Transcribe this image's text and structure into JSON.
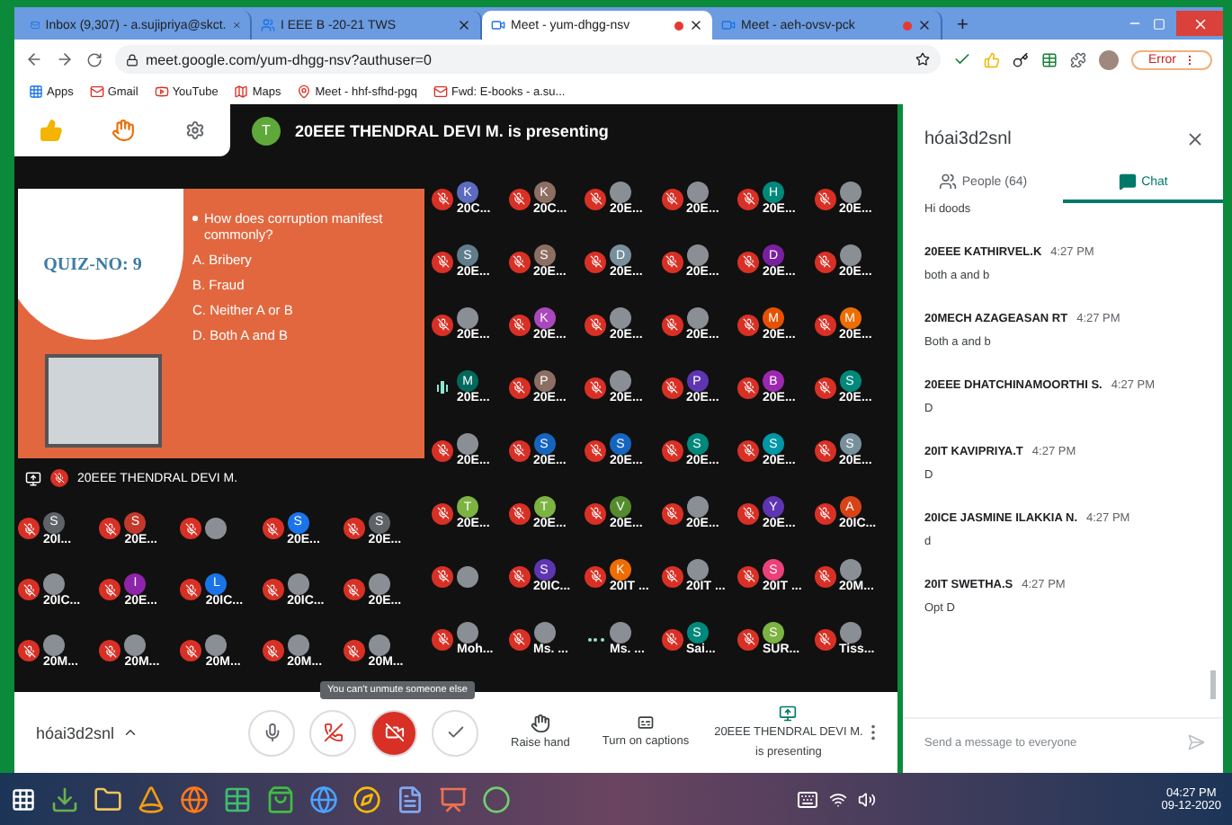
{
  "browser": {
    "tabs": [
      {
        "title": "Inbox (9,307) - a.sujipriya@skct.",
        "kind": "mail",
        "selected": false,
        "recording": false
      },
      {
        "title": "I EEE B -20-21 TWS",
        "kind": "people",
        "selected": false,
        "recording": false
      },
      {
        "title": "Meet - yum-dhgg-nsv",
        "kind": "meet",
        "selected": true,
        "recording": true
      },
      {
        "title": "Meet - aeh-ovsv-pck",
        "kind": "meet",
        "selected": false,
        "recording": true
      }
    ],
    "new_tab": "+",
    "address": "meet.google.com/yum-dhgg-nsv?authuser=0",
    "profile_button": "Error",
    "bookmarks": [
      {
        "label": "Apps",
        "kind": "apps"
      },
      {
        "label": "Gmail",
        "kind": "mail"
      },
      {
        "label": "YouTube",
        "kind": "video"
      },
      {
        "label": "Maps",
        "kind": "map"
      },
      {
        "label": "Meet - hhf-sfhd-pgq",
        "kind": "pin"
      },
      {
        "label": "Fwd: E-books - a.su...",
        "kind": "mail"
      }
    ]
  },
  "meet": {
    "banner": {
      "initial": "T",
      "text": "20EEE THENDRAL DEVI M. is presenting"
    },
    "slide": {
      "title": "QUIZ-NO: 9",
      "question": "How does corruption manifest commonly?",
      "options": [
        "A. Bribery",
        "B. Fraud",
        "C. Neither A or B",
        "D. Both A and B"
      ]
    },
    "presenter_caption": "20EEE THENDRAL DEVI M.",
    "tiles_left": [
      {
        "initial": "S",
        "color": "#5f6368",
        "kind": "letter",
        "label": "20I...",
        "muted": true,
        "speaking": false
      },
      {
        "initial": "S",
        "color": "#c0392b",
        "kind": "letter",
        "label": "20E...",
        "muted": true,
        "speaking": false
      },
      {
        "kind": "photo",
        "muted": true,
        "speaking": false
      },
      {
        "initial": "S",
        "color": "#1a73e8",
        "kind": "letter",
        "label": "20E...",
        "muted": true,
        "speaking": false
      },
      {
        "initial": "S",
        "color": "#5f6368",
        "kind": "letter",
        "label": "20E...",
        "muted": true,
        "speaking": false
      },
      {
        "kind": "photo",
        "label": "20IC...",
        "muted": true,
        "speaking": false
      },
      {
        "initial": "I",
        "color": "#8e24aa",
        "kind": "letter",
        "label": "20E...",
        "muted": true,
        "speaking": false
      },
      {
        "initial": "L",
        "color": "#1a73e8",
        "kind": "letter",
        "label": "20IC...",
        "muted": true,
        "speaking": false
      },
      {
        "kind": "photo",
        "label": "20IC...",
        "muted": true,
        "speaking": false
      },
      {
        "kind": "photo",
        "label": "20E...",
        "muted": true,
        "speaking": false
      },
      {
        "kind": "photo",
        "label": "20M...",
        "muted": true,
        "speaking": false
      },
      {
        "kind": "photo",
        "label": "20M...",
        "muted": true,
        "speaking": false
      },
      {
        "kind": "photo",
        "label": "20M...",
        "muted": true,
        "speaking": false
      },
      {
        "kind": "photo",
        "label": "20M...",
        "muted": true,
        "speaking": false
      },
      {
        "kind": "photo",
        "label": "20M...",
        "muted": true,
        "speaking": false
      }
    ],
    "tiles_right": [
      {
        "initial": "K",
        "color": "#5c6bc0",
        "kind": "letter",
        "label": "20C...",
        "muted": true,
        "speaking": false
      },
      {
        "initial": "K",
        "color": "#8d6e63",
        "kind": "letter",
        "label": "20C...",
        "muted": true,
        "speaking": false
      },
      {
        "kind": "photo",
        "label": "20E...",
        "muted": true,
        "speaking": false
      },
      {
        "kind": "photo",
        "label": "20E...",
        "muted": true,
        "speaking": false
      },
      {
        "initial": "H",
        "color": "#00897b",
        "kind": "letter",
        "label": "20E...",
        "muted": true,
        "speaking": false
      },
      {
        "kind": "photo",
        "label": "20E...",
        "muted": true,
        "speaking": false
      },
      {
        "initial": "S",
        "color": "#607d8b",
        "kind": "letter",
        "label": "20E...",
        "muted": true,
        "speaking": false
      },
      {
        "initial": "S",
        "color": "#8d6e63",
        "kind": "letter",
        "label": "20E...",
        "muted": true,
        "speaking": false
      },
      {
        "initial": "D",
        "color": "#78909c",
        "kind": "letter",
        "label": "20E...",
        "muted": true,
        "speaking": false
      },
      {
        "kind": "photo",
        "label": "20E...",
        "muted": true,
        "speaking": false
      },
      {
        "initial": "D",
        "color": "#7b1fa2",
        "kind": "letter",
        "label": "20E...",
        "muted": true,
        "speaking": false
      },
      {
        "kind": "photo",
        "label": "20E...",
        "muted": true,
        "speaking": false
      },
      {
        "kind": "photo",
        "label": "20E...",
        "muted": true,
        "speaking": false
      },
      {
        "initial": "K",
        "color": "#ab47bc",
        "kind": "letter",
        "label": "20E...",
        "muted": true,
        "speaking": false
      },
      {
        "kind": "photo",
        "label": "20E...",
        "muted": true,
        "speaking": false
      },
      {
        "kind": "photo",
        "label": "20E...",
        "muted": true,
        "speaking": false
      },
      {
        "initial": "M",
        "color": "#e65100",
        "kind": "letter",
        "label": "20E...",
        "muted": true,
        "speaking": false
      },
      {
        "initial": "M",
        "color": "#ef6c00",
        "kind": "letter",
        "label": "20E...",
        "muted": true,
        "speaking": false
      },
      {
        "initial": "M",
        "color": "#00695c",
        "kind": "letter",
        "label": "20E...",
        "muted": false,
        "speaking": true
      },
      {
        "initial": "P",
        "color": "#8d6e63",
        "kind": "letter",
        "label": "20E...",
        "muted": true,
        "speaking": false
      },
      {
        "kind": "photo",
        "label": "20E...",
        "muted": true,
        "speaking": false
      },
      {
        "initial": "P",
        "color": "#5e35b1",
        "kind": "letter",
        "label": "20E...",
        "muted": true,
        "speaking": false
      },
      {
        "initial": "B",
        "color": "#9c27b0",
        "kind": "letter",
        "label": "20E...",
        "muted": true,
        "speaking": false
      },
      {
        "initial": "S",
        "color": "#00897b",
        "kind": "letter",
        "label": "20E...",
        "muted": true,
        "speaking": false
      },
      {
        "kind": "photo",
        "label": "20E...",
        "muted": true,
        "speaking": false
      },
      {
        "initial": "S",
        "color": "#1565c0",
        "kind": "letter",
        "label": "20E...",
        "muted": true,
        "speaking": false
      },
      {
        "initial": "S",
        "color": "#1565c0",
        "kind": "letter",
        "label": "20E...",
        "muted": true,
        "speaking": false
      },
      {
        "initial": "S",
        "color": "#00897b",
        "kind": "letter",
        "label": "20E...",
        "muted": true,
        "speaking": false
      },
      {
        "initial": "S",
        "color": "#0097a7",
        "kind": "letter",
        "label": "20E...",
        "muted": true,
        "speaking": false
      },
      {
        "initial": "S",
        "color": "#78909c",
        "kind": "letter",
        "label": "20E...",
        "muted": true,
        "speaking": false
      },
      {
        "initial": "T",
        "color": "#7cb342",
        "kind": "letter",
        "label": "20E...",
        "muted": true,
        "speaking": false
      },
      {
        "initial": "T",
        "color": "#7cb342",
        "kind": "letter",
        "label": "20E...",
        "muted": true,
        "speaking": false
      },
      {
        "initial": "V",
        "color": "#558b2f",
        "kind": "letter",
        "label": "20E...",
        "muted": true,
        "speaking": false
      },
      {
        "kind": "photo",
        "label": "20E...",
        "muted": true,
        "speaking": false
      },
      {
        "initial": "Y",
        "color": "#5e35b1",
        "kind": "letter",
        "label": "20E...",
        "muted": true,
        "speaking": false
      },
      {
        "initial": "A",
        "color": "#d84315",
        "kind": "letter",
        "label": "20IC...",
        "muted": true,
        "speaking": false
      },
      {
        "kind": "photo",
        "muted": true,
        "speaking": false
      },
      {
        "initial": "S",
        "color": "#5e35b1",
        "kind": "letter",
        "label": "20IC...",
        "muted": true,
        "speaking": false
      },
      {
        "initial": "K",
        "color": "#ef6c00",
        "kind": "letter",
        "label": "20IT ...",
        "muted": true,
        "speaking": false
      },
      {
        "kind": "photo",
        "label": "20IT ...",
        "muted": true,
        "speaking": false
      },
      {
        "initial": "S",
        "color": "#ec407a",
        "kind": "letter",
        "label": "20IT ...",
        "muted": true,
        "speaking": false
      },
      {
        "kind": "photo",
        "label": "20M...",
        "muted": true,
        "speaking": false
      },
      {
        "kind": "photo",
        "label": "Moh...",
        "muted": true,
        "speaking": false
      },
      {
        "kind": "photo",
        "label": "Ms. ...",
        "muted": true,
        "speaking": false
      },
      {
        "kind": "photo",
        "label": "Ms. ...",
        "muted": false,
        "speaking": false
      },
      {
        "initial": "S",
        "color": "#00897b",
        "kind": "letter",
        "label": "Sai...",
        "muted": true,
        "speaking": false
      },
      {
        "initial": "S",
        "color": "#7cb342",
        "kind": "letter",
        "label": "SUR...",
        "muted": true,
        "speaking": false
      },
      {
        "kind": "photo",
        "label": "Tiss...",
        "muted": true,
        "speaking": false
      }
    ],
    "tooltip": "You can't unmute someone else",
    "controls": {
      "meeting_code": "hóai3d2snl",
      "mic_on": true,
      "camera_on": false,
      "raise_hand": "Raise hand",
      "captions": "Turn on captions",
      "presenting": [
        "20EEE THENDRAL DEVI M.",
        "is presenting"
      ]
    }
  },
  "chat": {
    "title": "hóai3d2snl",
    "tabs": [
      {
        "label": "People (64)",
        "kind": "people",
        "selected": false
      },
      {
        "label": "Chat",
        "kind": "chat",
        "selected": true
      }
    ],
    "partial_message": "Hi doods",
    "messages": [
      {
        "sender": "20EEE KATHIRVEL.K",
        "time": "4:27 PM",
        "text": "both a and b"
      },
      {
        "sender": "20MECH AZAGEASAN RT",
        "time": "4:27 PM",
        "text": "Both a and b"
      },
      {
        "sender": "20EEE DHATCHINAMOORTHI S.",
        "time": "4:27 PM",
        "text": "D"
      },
      {
        "sender": "20IT KAVIPRIYA.T",
        "time": "4:27 PM",
        "text": "D"
      },
      {
        "sender": "20ICE JASMINE ILAKKIA N.",
        "time": "4:27 PM",
        "text": "d"
      },
      {
        "sender": "20IT SWETHA.S",
        "time": "4:27 PM",
        "text": "Opt D"
      }
    ],
    "input_placeholder": "Send a message to everyone"
  },
  "taskbar": {
    "time": "04:27 PM",
    "date": "09-12-2020"
  }
}
